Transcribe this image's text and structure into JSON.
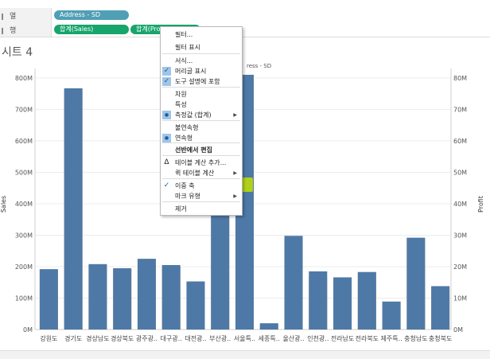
{
  "shelves": {
    "columns": {
      "label": "열",
      "pills": [
        {
          "text": "Address - SD"
        }
      ]
    },
    "rows": {
      "label": "행",
      "pills": [
        {
          "text": "합계(Sales)"
        },
        {
          "text": "합계(Profit)"
        }
      ]
    }
  },
  "sheet": {
    "title": "시트 4",
    "header": "ress - SD"
  },
  "context_menu": {
    "items": [
      {
        "label": "필터..."
      },
      {
        "label": "필터 표시"
      },
      {
        "label": "서식..."
      },
      {
        "label": "머리글 표시",
        "checked": true
      },
      {
        "label": "도구 설명에 포함",
        "checked": true
      },
      {
        "label": "차원"
      },
      {
        "label": "특성"
      },
      {
        "label": "측정값 (합계)",
        "radio": true,
        "submenu": true
      },
      {
        "label": "불연속형"
      },
      {
        "label": "연속형",
        "radio": true
      },
      {
        "label": "선반에서 편집",
        "bold": true
      },
      {
        "label": "테이블 계산 추가...",
        "icon": "delta-icon"
      },
      {
        "label": "퀵 테이블 계산",
        "submenu": true
      },
      {
        "label": "이중 축",
        "checked": true,
        "highlighted": true
      },
      {
        "label": "마크 유형",
        "submenu": true
      },
      {
        "label": "제거"
      }
    ]
  },
  "colors": {
    "bar": "#4e79a7",
    "profit": "#f28e2b",
    "highlight": "#c3e000",
    "pill_dimension": "#4f9fb5",
    "pill_measure": "#17a56b"
  },
  "chart_data": {
    "type": "bar",
    "ylabel": "Sales",
    "y2label": "Profit",
    "ylim": [
      0,
      820
    ],
    "y2lim": [
      0,
      82
    ],
    "yticks": [
      "0M",
      "100M",
      "200M",
      "300M",
      "400M",
      "500M",
      "600M",
      "700M",
      "800M"
    ],
    "y2ticks": [
      "0M",
      "10M",
      "20M",
      "30M",
      "40M",
      "50M",
      "60M",
      "70M",
      "80M"
    ],
    "categories": [
      "강원도",
      "경기도",
      "경상남도",
      "경상북도",
      "광주광..",
      "대구광..",
      "대전광..",
      "부산광..",
      "서울특..",
      "세종특..",
      "울산광..",
      "인천광..",
      "전라남도",
      "전라북도",
      "제주특..",
      "충청남도",
      "충청북도"
    ],
    "series": [
      {
        "name": "Sales",
        "values": [
          192,
          767,
          208,
          195,
          225,
          205,
          153,
          370,
          810,
          20,
          298,
          185,
          166,
          183,
          89,
          292,
          138
        ]
      },
      {
        "name": "Profit",
        "values": [
          19,
          76,
          20,
          19,
          22,
          20,
          15,
          36,
          80,
          1.5,
          29,
          16.5,
          16,
          18,
          8.8,
          29,
          13.6
        ]
      }
    ]
  }
}
